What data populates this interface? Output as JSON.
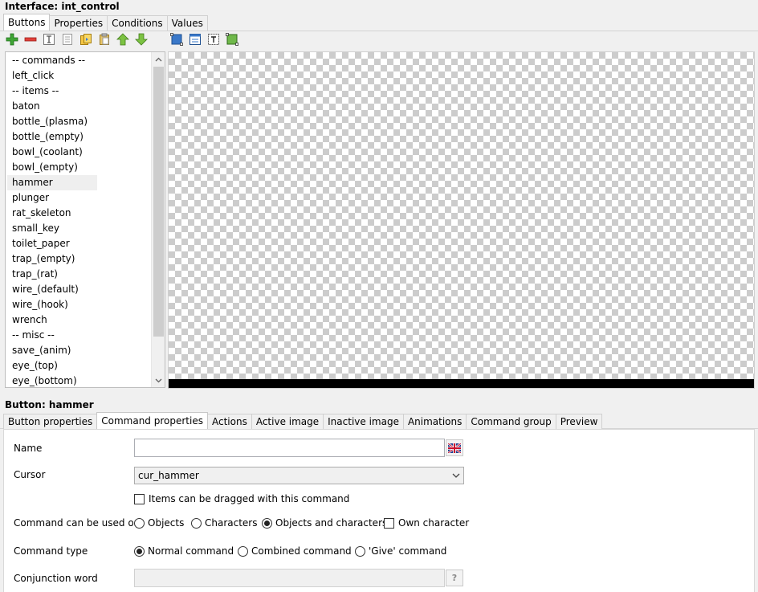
{
  "window": {
    "title": "Interface: int_control"
  },
  "top_tabs": [
    {
      "label": "Buttons",
      "active": true
    },
    {
      "label": "Properties",
      "active": false
    },
    {
      "label": "Conditions",
      "active": false
    },
    {
      "label": "Values",
      "active": false
    }
  ],
  "toolbar": {
    "buttons": [
      {
        "name": "add-icon"
      },
      {
        "name": "remove-icon"
      },
      {
        "name": "text-frame-icon"
      },
      {
        "name": "list-icon"
      },
      {
        "name": "copy-icon"
      },
      {
        "name": "paste-icon"
      },
      {
        "name": "move-up-icon"
      },
      {
        "name": "move-down-icon"
      },
      {
        "name": "select-area-icon"
      },
      {
        "name": "window-frame-icon"
      },
      {
        "name": "text-area-icon"
      },
      {
        "name": "image-area-icon"
      }
    ]
  },
  "button_list": {
    "items": [
      "-- commands --",
      "left_click",
      "-- items --",
      "baton",
      "bottle_(plasma)",
      "bottle_(empty)",
      "bowl_(coolant)",
      "bowl_(empty)",
      "hammer",
      "plunger",
      "rat_skeleton",
      "small_key",
      "toilet_paper",
      "trap_(empty)",
      "trap_(rat)",
      "wire_(default)",
      "wire_(hook)",
      "wrench",
      "-- misc --",
      "save_(anim)",
      "eye_(top)",
      "eye_(bottom)"
    ],
    "selected": "hammer"
  },
  "button_section": {
    "title": "Button: hammer"
  },
  "bottom_tabs": [
    {
      "label": "Button properties",
      "active": false
    },
    {
      "label": "Command properties",
      "active": true
    },
    {
      "label": "Actions",
      "active": false
    },
    {
      "label": "Active image",
      "active": false
    },
    {
      "label": "Inactive image",
      "active": false
    },
    {
      "label": "Animations",
      "active": false
    },
    {
      "label": "Command group",
      "active": false
    },
    {
      "label": "Preview",
      "active": false
    }
  ],
  "form": {
    "name_label": "Name",
    "name_value": "",
    "cursor_label": "Cursor",
    "cursor_value": "cur_hammer",
    "drag_checkbox_label": "Items can be dragged with this command",
    "drag_checked": false,
    "used_on_label": "Command can be used on",
    "used_on_options": {
      "objects": "Objects",
      "characters": "Characters",
      "objects_and_characters": "Objects and characters"
    },
    "used_on_selected": "Objects and characters",
    "own_character_label": "Own character",
    "own_character_checked": false,
    "type_label": "Command type",
    "type_options": {
      "normal": "Normal command",
      "combined": "Combined command",
      "give": "'Give' command"
    },
    "type_selected": "Normal command",
    "conjunction_label": "Conjunction word",
    "conjunction_value": "",
    "help_button_label": "?"
  },
  "colors": {
    "selection": "#efefef",
    "canvas_bar": "#000000"
  }
}
